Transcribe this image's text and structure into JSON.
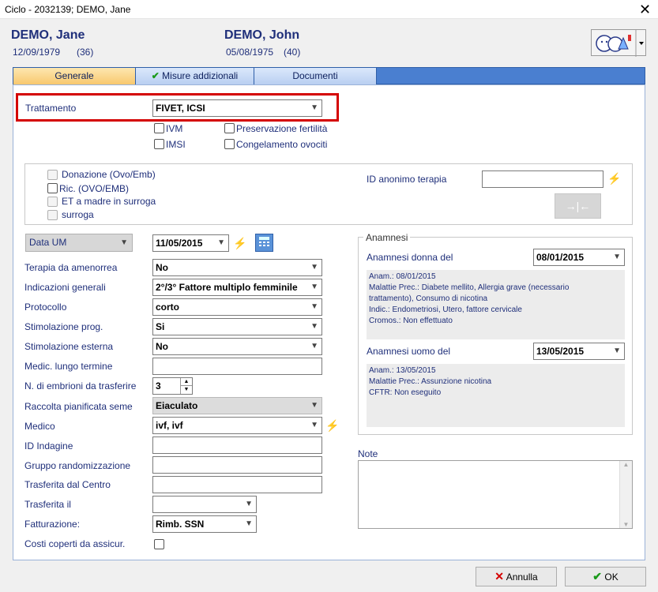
{
  "window": {
    "title": "Ciclo - 2032139; DEMO, Jane",
    "close": "✕"
  },
  "patient_female": {
    "name": "DEMO, Jane",
    "dob": "12/09/1979",
    "age": "(36)"
  },
  "patient_male": {
    "name": "DEMO, John",
    "dob": "05/08/1975",
    "age": "(40)"
  },
  "tabs": [
    {
      "label": "Generale"
    },
    {
      "label": "Misure addizionali"
    },
    {
      "label": "Documenti"
    }
  ],
  "trattamento": {
    "label": "Trattamento",
    "value": "FIVET, ICSI"
  },
  "treatment_options": {
    "ivm": "IVM",
    "imsi": "IMSI",
    "preservazione": "Preservazione fertilità",
    "congelamento": "Congelamento ovociti"
  },
  "donation": {
    "donazione": "Donazione (Ovo/Emb)",
    "ric": "Ric. (OVO/EMB)",
    "et_madre": "ET a madre in surroga",
    "surroga": "surroga",
    "id_anonimo_label": "ID anonimo terapia",
    "id_anonimo_value": ""
  },
  "date_um": {
    "selector": "Data UM",
    "value": "11/05/2015"
  },
  "form": [
    {
      "label": "Terapia da amenorrea",
      "value": "No",
      "type": "combo"
    },
    {
      "label": "Indicazioni generali",
      "value": "2°/3° Fattore multiplo femminile",
      "type": "combo"
    },
    {
      "label": "Protocollo",
      "value": "corto",
      "type": "combo"
    },
    {
      "label": "Stimolazione prog.",
      "value": "Si",
      "type": "combo"
    },
    {
      "label": "Stimolazione esterna",
      "value": "No",
      "type": "combo"
    },
    {
      "label": "Medic. lungo termine",
      "value": "",
      "type": "text"
    },
    {
      "label": "N. di embrioni da trasferire",
      "value": "3",
      "type": "spin"
    },
    {
      "label": "Raccolta pianificata seme",
      "value": "Eiaculato",
      "type": "combo-dis"
    },
    {
      "label": "Medico",
      "value": "ivf, ivf",
      "type": "combo"
    },
    {
      "label": "ID Indagine",
      "value": "",
      "type": "text"
    },
    {
      "label": "Gruppo randomizzazione",
      "value": "",
      "type": "text"
    },
    {
      "label": "Trasferita dal Centro",
      "value": "",
      "type": "text"
    },
    {
      "label": "Trasferita il",
      "value": "",
      "type": "combo-short"
    },
    {
      "label": "Fatturazione:",
      "value": "Rimb. SSN",
      "type": "combo-short"
    },
    {
      "label": "Costi coperti da assicur.",
      "value": "",
      "type": "check"
    }
  ],
  "anamnesi": {
    "group_title": "Anamnesi",
    "donna_label": "Anamnesi donna del",
    "donna_date": "08/01/2015",
    "donna_lines": [
      "Anam.: 08/01/2015",
      "Malattie Prec.: Diabete mellito, Allergia grave (necessario",
      "trattamento), Consumo di nicotina",
      "Indic.: Endometriosi, Utero, fattore cervicale",
      "Cromos.: Non effettuato"
    ],
    "uomo_label": "Anamnesi uomo del",
    "uomo_date": "13/05/2015",
    "uomo_lines": [
      "Anam.: 13/05/2015",
      "Malattie Prec.: Assunzione nicotina",
      "CFTR: Non eseguito"
    ]
  },
  "note": {
    "label": "Note",
    "value": ""
  },
  "buttons": {
    "cancel": "Annulla",
    "ok": "OK"
  },
  "colors": {
    "tab_active": "#f8c86e",
    "tab_bar": "#4a7fd0",
    "highlight": "#d40000",
    "label_text": "#1f2f7a"
  }
}
